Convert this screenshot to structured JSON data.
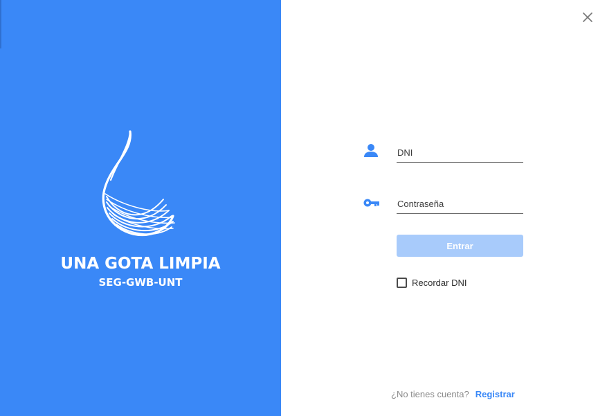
{
  "brand": {
    "title": "UNA GOTA LIMPIA",
    "subtitle": "SEG-GWB-UNT",
    "background_color": "#3a88f7",
    "logo_icon": "water-drop-logo-icon"
  },
  "window": {
    "close_icon": "close-icon"
  },
  "login_form": {
    "dni": {
      "icon": "person-icon",
      "value": "",
      "placeholder": "DNI"
    },
    "password": {
      "icon": "key-icon",
      "value": "",
      "placeholder": "Contraseña"
    },
    "submit_label": "Entrar",
    "submit_color": "#a8cbfb",
    "remember_label": "Recordar DNI",
    "remember_checked": false
  },
  "footer": {
    "prompt_text": "¿No tienes cuenta?",
    "register_label": "Registrar",
    "link_color": "#3a88f7"
  }
}
